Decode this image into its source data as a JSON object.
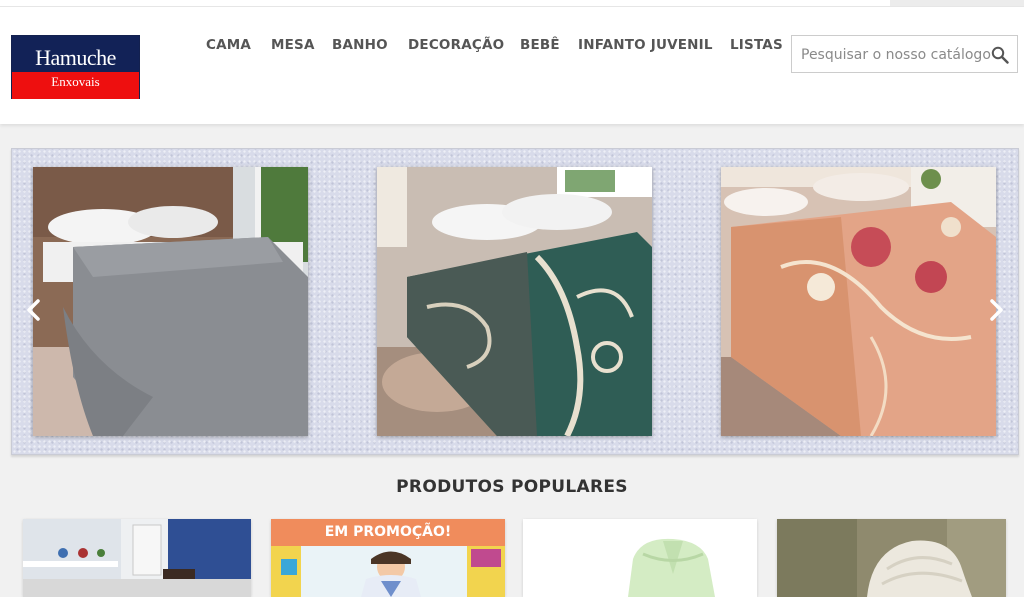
{
  "brand": {
    "name": "Hamuche",
    "tagline": "Enxovais",
    "colors": {
      "navy": "#122257",
      "red": "#ee0f0f"
    }
  },
  "nav": {
    "items": [
      "CAMA",
      "MESA",
      "BANHO",
      "DECORAÇÃO",
      "BEBÊ",
      "INFANTO JUVENIL",
      "LISTAS"
    ]
  },
  "search": {
    "placeholder": "Pesquisar o nosso catálogo",
    "icon": "search-icon"
  },
  "carousel": {
    "icons": {
      "prev": "chevron-left-icon",
      "next": "chevron-right-icon"
    },
    "slides": [
      {
        "image": "gray-bedspread-bedroom"
      },
      {
        "image": "green-scroll-blanket-bedroom"
      },
      {
        "image": "peach-floral-blanket-bedroom"
      }
    ]
  },
  "popular": {
    "title": "PRODUTOS POPULARES",
    "promo_label": "EM PROMOÇÃO!",
    "products": [
      {
        "image": "kids-room"
      },
      {
        "image": "child-pajamas",
        "on_sale": true
      },
      {
        "image": "green-bathrobe"
      },
      {
        "image": "towel-turban"
      }
    ]
  }
}
